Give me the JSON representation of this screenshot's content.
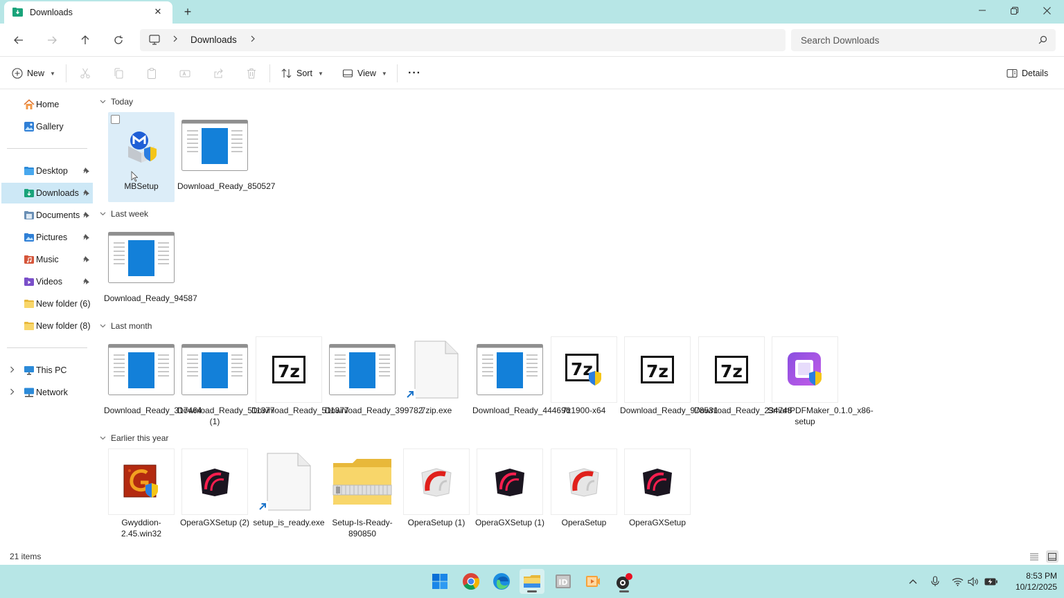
{
  "window": {
    "tab_title": "Downloads",
    "new_tab_symbol": "+",
    "close_tab_symbol": "✕"
  },
  "address": {
    "location": "Downloads"
  },
  "search": {
    "placeholder": "Search Downloads"
  },
  "toolbar": {
    "new_label": "New",
    "sort_label": "Sort",
    "view_label": "View",
    "more_label": "···",
    "details_label": "Details"
  },
  "sidebar": {
    "quick": [
      {
        "label": "Home"
      },
      {
        "label": "Gallery"
      }
    ],
    "pinned": [
      {
        "label": "Desktop"
      },
      {
        "label": "Downloads"
      },
      {
        "label": "Documents"
      },
      {
        "label": "Pictures"
      },
      {
        "label": "Music"
      },
      {
        "label": "Videos"
      },
      {
        "label": "New folder (6)"
      },
      {
        "label": "New folder (8)"
      }
    ],
    "locations": [
      {
        "label": "This PC"
      },
      {
        "label": "Network"
      }
    ]
  },
  "groups": [
    {
      "label": "Today",
      "files": [
        {
          "name": "MBSetup",
          "icon": "malwarebytes-installer-icon"
        },
        {
          "name": "Download_Ready_850527",
          "icon": "window-app-icon"
        }
      ]
    },
    {
      "label": "Last week",
      "files": [
        {
          "name": "Download_Ready_94587",
          "icon": "window-app-icon"
        }
      ]
    },
    {
      "label": "Last month",
      "files": [
        {
          "name": "Download_Ready_317464",
          "icon": "window-app-icon"
        },
        {
          "name": "Download_Ready_511377 (1)",
          "icon": "window-app-icon"
        },
        {
          "name": "Download_Ready_511377",
          "icon": "7zip-icon"
        },
        {
          "name": "Download_Ready_399782",
          "icon": "window-app-icon"
        },
        {
          "name": "7zip.exe",
          "icon": "blank-shortcut-icon"
        },
        {
          "name": "Download_Ready_444696",
          "icon": "window-app-icon"
        },
        {
          "name": "7z1900-x64",
          "icon": "7zip-shield-icon"
        },
        {
          "name": "Download_Ready_978531",
          "icon": "7zip-icon"
        },
        {
          "name": "Download_Ready_234748",
          "icon": "7zip-icon"
        },
        {
          "name": "SmartPDFMaker_0.1.0_x86-setup",
          "icon": "smartpdf-icon"
        }
      ]
    },
    {
      "label": "Earlier this year",
      "files": [
        {
          "name": "Gwyddion-2.45.win32",
          "icon": "gwyddion-icon"
        },
        {
          "name": "OperaGXSetup (2)",
          "icon": "opera-gx-icon"
        },
        {
          "name": "setup_is_ready.exe",
          "icon": "blank-shortcut-icon"
        },
        {
          "name": "Setup-Is-Ready-890850",
          "icon": "zip-folder-icon"
        },
        {
          "name": "OperaSetup (1)",
          "icon": "opera-icon"
        },
        {
          "name": "OperaGXSetup (1)",
          "icon": "opera-gx-icon"
        },
        {
          "name": "OperaSetup",
          "icon": "opera-icon"
        },
        {
          "name": "OperaGXSetup",
          "icon": "opera-gx-icon"
        }
      ]
    }
  ],
  "status": {
    "item_count": "21 items"
  },
  "taskbar": {
    "time": "8:53 PM",
    "date": "10/12/2025"
  },
  "colors": {
    "chrome_bg": "#b7e6e6",
    "selection": "#cde8f6",
    "accent": "#0078d4"
  }
}
